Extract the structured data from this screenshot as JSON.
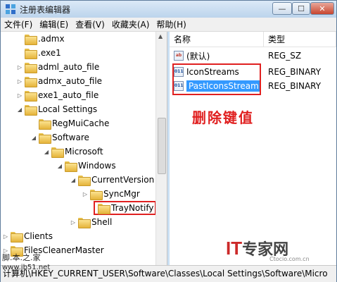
{
  "window": {
    "title": "注册表编辑器",
    "minimize": "—",
    "maximize": "☐",
    "close": "✕"
  },
  "menu": [
    "文件(F)",
    "编辑(E)",
    "查看(V)",
    "收藏夹(A)",
    "帮助(H)"
  ],
  "tree": [
    {
      "label": ".admx",
      "expander": ""
    },
    {
      "label": ".exe1",
      "expander": ""
    },
    {
      "label": "adml_auto_file",
      "expander": "▷"
    },
    {
      "label": "admx_auto_file",
      "expander": "▷"
    },
    {
      "label": "exe1_auto_file",
      "expander": "▷"
    },
    {
      "label": "Local Settings",
      "expander": "◢"
    },
    {
      "label": "RegMuiCache",
      "expander": ""
    },
    {
      "label": "Software",
      "expander": "◢"
    },
    {
      "label": "Microsoft",
      "expander": "◢"
    },
    {
      "label": "Windows",
      "expander": "◢"
    },
    {
      "label": "CurrentVersion",
      "expander": "◢"
    },
    {
      "label": "SyncMgr",
      "expander": "▷"
    },
    {
      "label": "TrayNotify",
      "expander": ""
    },
    {
      "label": "Shell",
      "expander": "▷"
    },
    {
      "label": "Clients",
      "expander": "▷"
    },
    {
      "label": "FilesCleanerMaster",
      "expander": "▷"
    }
  ],
  "list": {
    "header_name": "名称",
    "header_type": "类型",
    "rows": [
      {
        "name": "(默认)",
        "type": "REG_SZ",
        "icon": "ab"
      },
      {
        "name": "IconStreams",
        "type": "REG_BINARY",
        "icon": "011"
      },
      {
        "name": "PastIconsStream",
        "type": "REG_BINARY",
        "icon": "011"
      }
    ],
    "annotation": "删除键值"
  },
  "statusbar": "计算机\\HKEY_CURRENT_USER\\Software\\Classes\\Local Settings\\Software\\Micro",
  "watermark": {
    "left_line1": "脚.本.之.家",
    "left_line2": "www.jb51.net",
    "logo_it": "IT",
    "logo_cn": "专家网",
    "site": "Ctocio.com.cn"
  },
  "colors": {
    "annotation_red": "#e02020",
    "selection_blue": "#3399ff"
  }
}
